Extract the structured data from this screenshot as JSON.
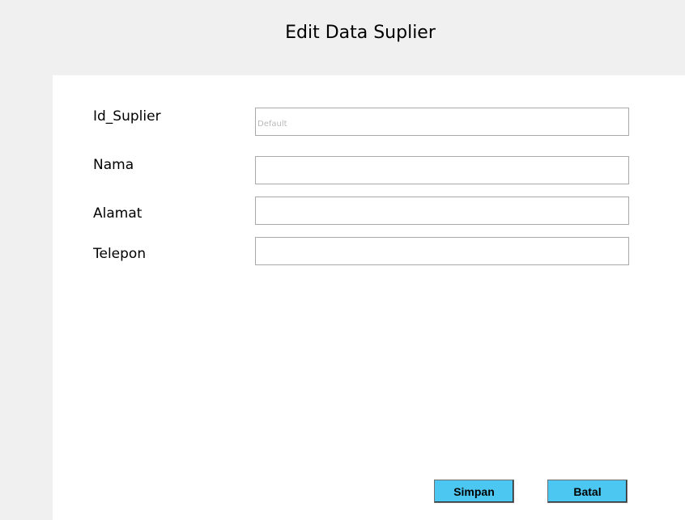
{
  "window": {
    "title": "Edit Data Suplier"
  },
  "form": {
    "fields": [
      {
        "label": "Id_Suplier",
        "value": "",
        "placeholder": "Default"
      },
      {
        "label": "Nama",
        "value": "",
        "placeholder": ""
      },
      {
        "label": "Alamat",
        "value": "",
        "placeholder": ""
      },
      {
        "label": "Telepon",
        "value": "",
        "placeholder": ""
      }
    ]
  },
  "buttons": {
    "save_label": "Simpan",
    "cancel_label": "Batal"
  },
  "colors": {
    "background": "#f0f0f0",
    "panel": "#ffffff",
    "button": "#4cc7f2",
    "field_border": "#a9a9a9"
  }
}
